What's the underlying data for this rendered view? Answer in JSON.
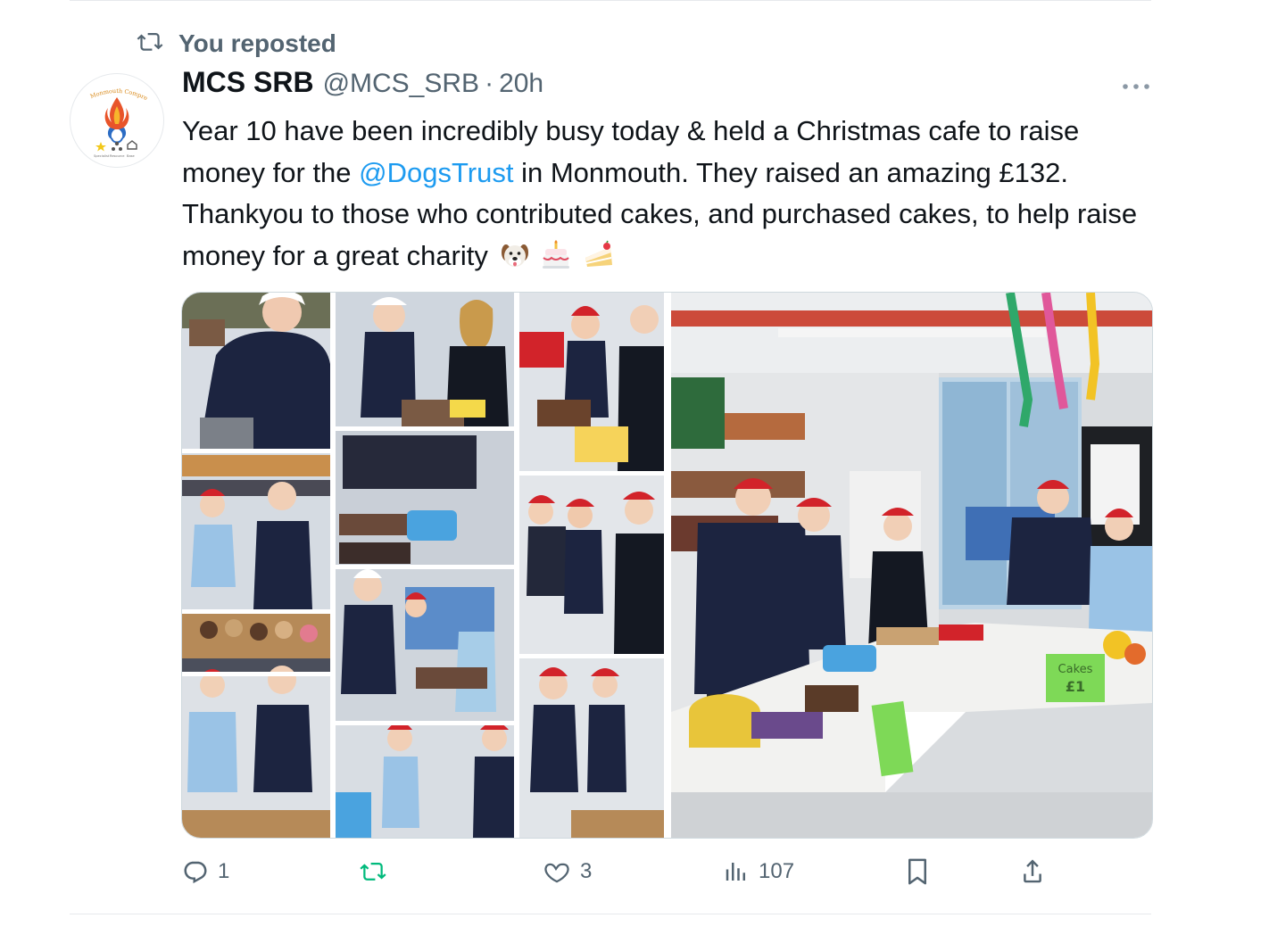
{
  "context": {
    "text": "You reposted",
    "icon": "repost-icon"
  },
  "author": {
    "name": "MCS SRB",
    "handle": "@MCS_SRB",
    "separator": "·",
    "time": "20h",
    "avatar_text_top": "Monmouth Comprehensive",
    "avatar_text_bottom": [
      "Specialist",
      "Resource",
      "Base"
    ]
  },
  "tweet": {
    "text_part1": "Year 10 have been incredibly busy today & held a Christmas cafe to raise money for the ",
    "mention": "@DogsTrust",
    "text_part2": " in Monmouth. They raised an amazing £132. Thankyou to those who contributed cakes, and purchased cakes, to help raise money for a great charity",
    "emojis": [
      "dog-face-emoji",
      "birthday-cake-emoji",
      "shortcake-emoji"
    ]
  },
  "media": {
    "photo_left": "collage-photo",
    "photo_right": "classroom-cake-sale-photo",
    "cake_sign": "Cakes",
    "cake_price": "£1"
  },
  "actions": {
    "reply": {
      "icon": "reply-icon",
      "count": "1"
    },
    "repost": {
      "icon": "repost-icon",
      "count": "",
      "color": "#00ba7c"
    },
    "like": {
      "icon": "heart-icon",
      "count": "3"
    },
    "views": {
      "icon": "views-icon",
      "count": "107"
    },
    "bookmark": {
      "icon": "bookmark-icon"
    },
    "share": {
      "icon": "share-icon"
    }
  },
  "colors": {
    "accent": "#1d9bf0",
    "secondary_text": "#536471",
    "primary_text": "#0f1419",
    "repost_green": "#00ba7c"
  }
}
